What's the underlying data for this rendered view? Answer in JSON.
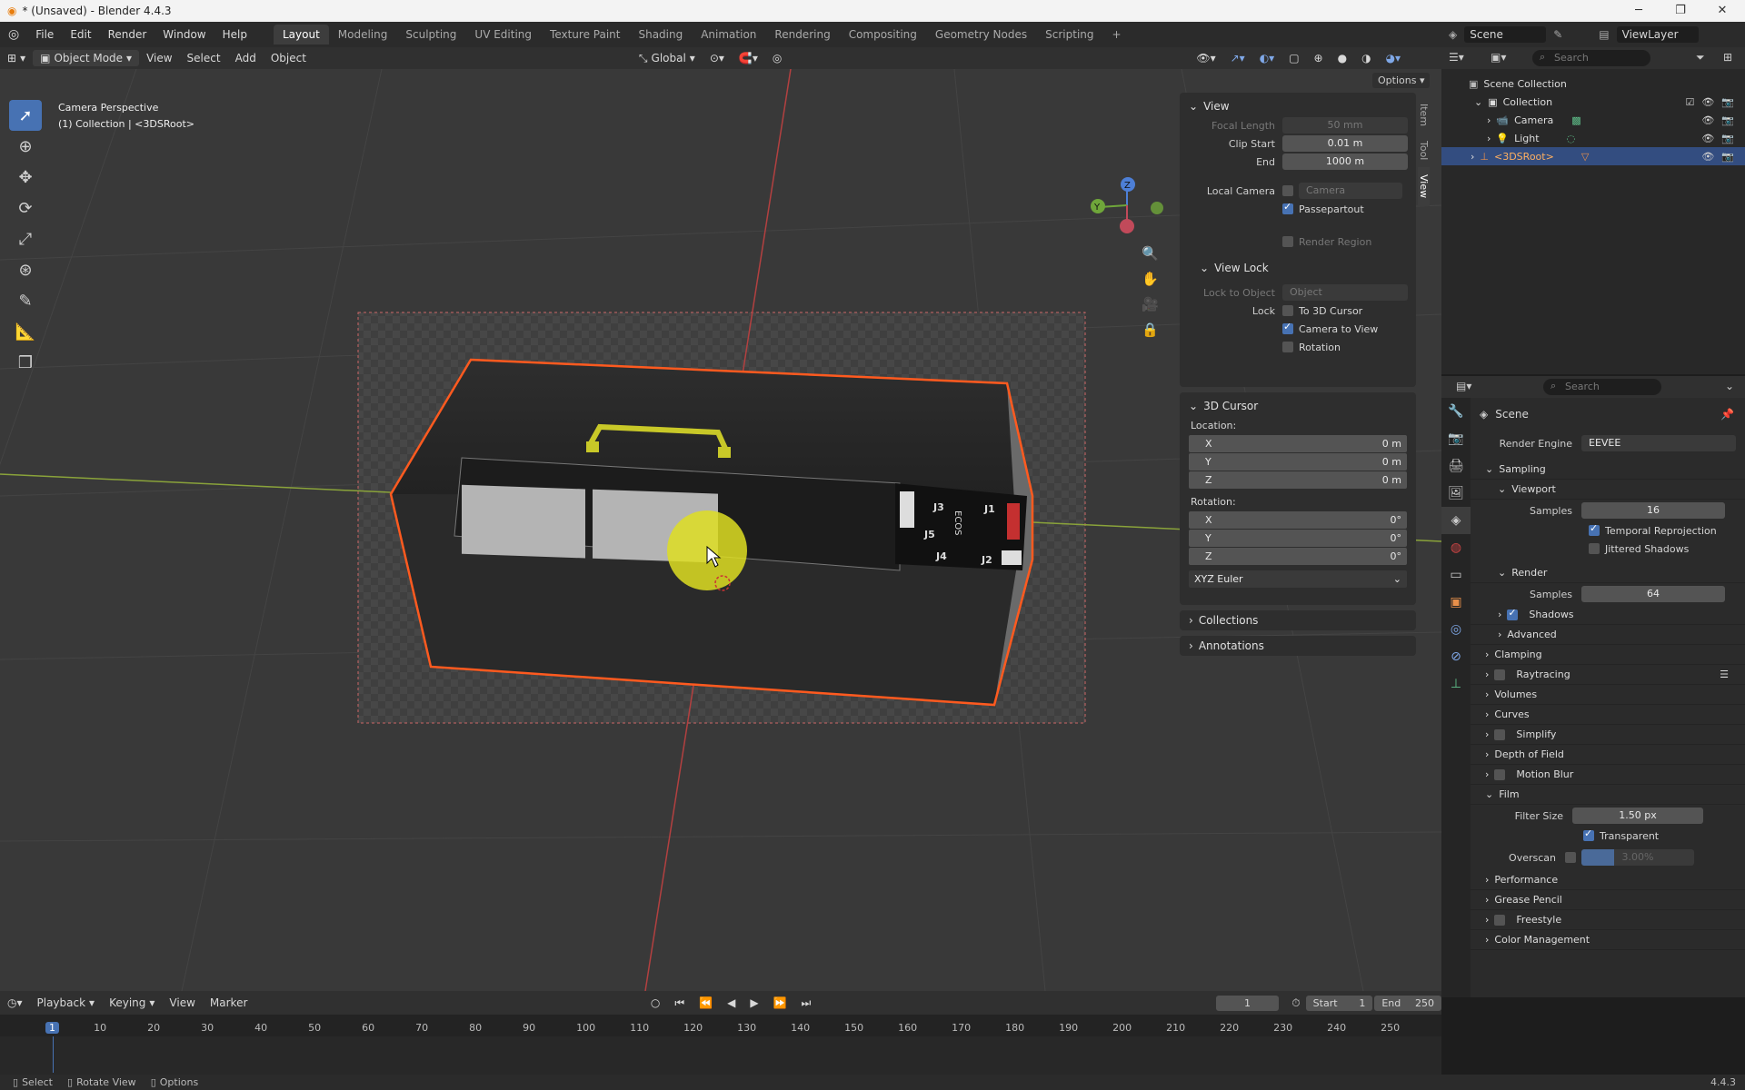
{
  "window": {
    "title": "* (Unsaved) - Blender 4.4.3",
    "minimize": "─",
    "maximize": "❐",
    "close": "✕"
  },
  "menu": {
    "items": [
      "File",
      "Edit",
      "Render",
      "Window",
      "Help"
    ],
    "workspaces": [
      "Layout",
      "Modeling",
      "Sculpting",
      "UV Editing",
      "Texture Paint",
      "Shading",
      "Animation",
      "Rendering",
      "Compositing",
      "Geometry Nodes",
      "Scripting"
    ],
    "add_tab": "+"
  },
  "scene_bar": {
    "scene": "Scene",
    "view_layer": "ViewLayer"
  },
  "viewport_header": {
    "mode": "Object Mode",
    "menus": [
      "View",
      "Select",
      "Add",
      "Object"
    ],
    "transform": "Global",
    "options": "Options"
  },
  "viewport": {
    "info_line1": "Camera Perspective",
    "info_line2": "(1) Collection | <3DSRoot>",
    "labels": [
      "J3",
      "J1",
      "J5",
      "J4",
      "J2",
      "ECOS"
    ]
  },
  "npanel": {
    "view": {
      "header": "View",
      "focal_length_label": "Focal Length",
      "focal_length": "50 mm",
      "clip_start_label": "Clip Start",
      "clip_start": "0.01 m",
      "end_label": "End",
      "end": "1000 m",
      "local_camera_label": "Local Camera",
      "local_camera": "Camera",
      "passepartout": "Passepartout",
      "render_region": "Render Region"
    },
    "view_lock": {
      "header": "View Lock",
      "lock_to_object_label": "Lock to Object",
      "lock_to_object": "Object",
      "lock_label": "Lock",
      "to_3d_cursor": "To 3D Cursor",
      "camera_to_view": "Camera to View",
      "rotation": "Rotation"
    },
    "cursor": {
      "header": "3D Cursor",
      "location_label": "Location:",
      "loc": [
        {
          "axis": "X",
          "value": "0 m"
        },
        {
          "axis": "Y",
          "value": "0 m"
        },
        {
          "axis": "Z",
          "value": "0 m"
        }
      ],
      "rotation_label": "Rotation:",
      "rot": [
        {
          "axis": "X",
          "value": "0°"
        },
        {
          "axis": "Y",
          "value": "0°"
        },
        {
          "axis": "Z",
          "value": "0°"
        }
      ],
      "mode": "XYZ Euler"
    },
    "collections": "Collections",
    "annotations": "Annotations",
    "tabs": [
      "Item",
      "Tool",
      "View"
    ]
  },
  "outliner": {
    "search_placeholder": "Search",
    "scene_collection": "Scene Collection",
    "collection": "Collection",
    "camera": "Camera",
    "light": "Light",
    "root": "<3DSRoot>"
  },
  "properties": {
    "search_placeholder": "Search",
    "context": "Scene",
    "render_engine_label": "Render Engine",
    "render_engine": "EEVEE",
    "sampling": "Sampling",
    "viewport": "Viewport",
    "samples_label": "Samples",
    "viewport_samples": "16",
    "temporal_reprojection": "Temporal Reprojection",
    "jittered_shadows": "Jittered Shadows",
    "render": "Render",
    "render_samples": "64",
    "shadows": "Shadows",
    "advanced": "Advanced",
    "clamping": "Clamping",
    "raytracing": "Raytracing",
    "volumes": "Volumes",
    "curves": "Curves",
    "simplify": "Simplify",
    "depth_of_field": "Depth of Field",
    "motion_blur": "Motion Blur",
    "film": "Film",
    "filter_size_label": "Filter Size",
    "filter_size": "1.50 px",
    "transparent": "Transparent",
    "overscan_label": "Overscan",
    "overscan": "3.00%",
    "performance": "Performance",
    "grease_pencil": "Grease Pencil",
    "freestyle": "Freestyle",
    "color_management": "Color Management"
  },
  "timeline": {
    "menus": [
      "Playback",
      "Keying",
      "View",
      "Marker"
    ],
    "current_frame": "1",
    "start_label": "Start",
    "start": "1",
    "end_label": "End",
    "end": "250",
    "ticks": [
      "1",
      "10",
      "20",
      "30",
      "40",
      "50",
      "60",
      "70",
      "80",
      "90",
      "100",
      "110",
      "120",
      "130",
      "140",
      "150",
      "160",
      "170",
      "180",
      "190",
      "200",
      "210",
      "220",
      "230",
      "240",
      "250"
    ]
  },
  "statusbar": {
    "select": "Select",
    "rotate_view": "Rotate View",
    "options": "Options",
    "version": "4.4.3"
  }
}
